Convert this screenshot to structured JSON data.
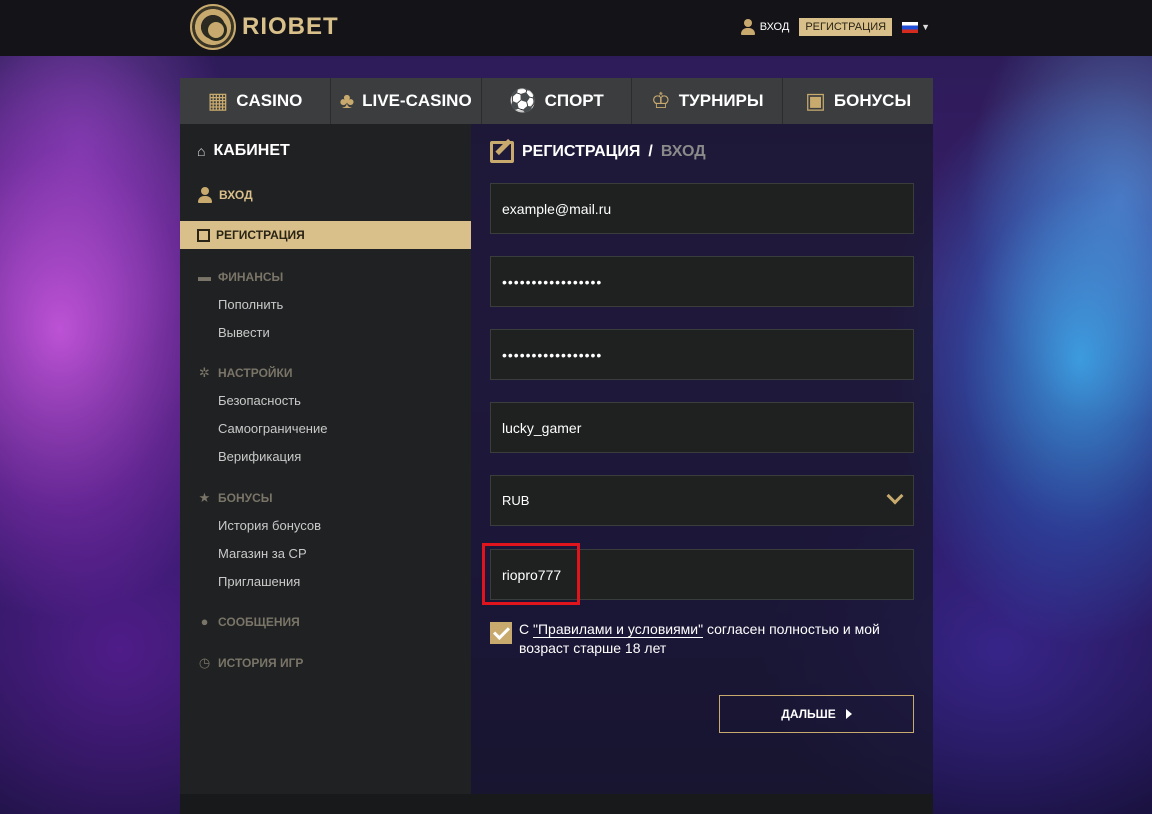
{
  "header": {
    "brand": "RIOBET",
    "login_label": "ВХОД",
    "register_label": "РЕГИСТРАЦИЯ",
    "language": "ru"
  },
  "nav": {
    "items": [
      {
        "label": "CASINO",
        "icon": "slot-machine-icon"
      },
      {
        "label": "LIVE-CASINO",
        "icon": "dealer-icon"
      },
      {
        "label": "СПОРТ",
        "icon": "soccer-ball-icon"
      },
      {
        "label": "ТУРНИРЫ",
        "icon": "trophy-icon"
      },
      {
        "label": "БОНУСЫ",
        "icon": "gift-icon"
      }
    ]
  },
  "sidebar": {
    "title": "КАБИНЕТ",
    "login": "ВХОД",
    "register": "РЕГИСТРАЦИЯ",
    "finance": {
      "title": "ФИНАНСЫ",
      "items": [
        "Пополнить",
        "Вывести"
      ]
    },
    "settings": {
      "title": "НАСТРОЙКИ",
      "items": [
        "Безопасность",
        "Самоограничение",
        "Верификация"
      ]
    },
    "bonuses": {
      "title": "БОНУСЫ",
      "items": [
        "История бонусов",
        "Магазин за СР",
        "Приглашения"
      ]
    },
    "messages": "СООБЩЕНИЯ",
    "game_history": "ИСТОРИЯ ИГР"
  },
  "form": {
    "title_active": "РЕГИСТРАЦИЯ",
    "title_separator": "/",
    "title_inactive": "ВХОД",
    "email": "example@mail.ru",
    "password": "•••••••••••••••••",
    "password_confirm": "•••••••••••••••••",
    "username": "lucky_gamer",
    "currency": "RUB",
    "promo_code": "riopro777",
    "agree_prefix": "С ",
    "agree_link": "\"Правилами и условиями\"",
    "agree_suffix": " согласен полностью и мой возраст старше 18 лет",
    "agree_checked": true,
    "next_label": "ДАЛЬШЕ"
  },
  "colors": {
    "accent": "#c8aa6e",
    "highlight": "#e0141c"
  }
}
